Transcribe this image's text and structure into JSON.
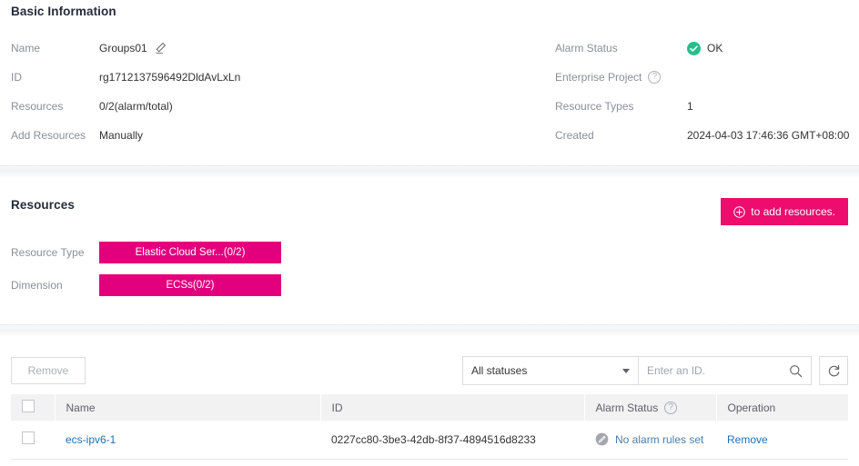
{
  "basic_information": {
    "title": "Basic Information",
    "left_rows": [
      {
        "label": "Name",
        "value": "Groups01",
        "icon": "pencil-icon"
      },
      {
        "label": "ID",
        "value": "rg1712137596492DldAvLxLn",
        "icon": ""
      },
      {
        "label": "Resources",
        "value": "0/2(alarm/total)",
        "icon": ""
      },
      {
        "label": "Add Resources",
        "value": "Manually",
        "icon": ""
      }
    ],
    "right_rows": [
      {
        "label": "Alarm Status",
        "value": "OK",
        "label_icon": "",
        "value_icon": "ok-check-icon"
      },
      {
        "label": "Enterprise Project",
        "value": "",
        "label_icon": "help-icon",
        "value_icon": ""
      },
      {
        "label": "Resource Types",
        "value": "1",
        "label_icon": "",
        "value_icon": ""
      },
      {
        "label": "Created",
        "value": "2024-04-03 17:46:36 GMT+08:00",
        "label_icon": "",
        "value_icon": ""
      }
    ]
  },
  "resources": {
    "title": "Resources",
    "add_button": {
      "label": "to add resources.",
      "icon": "plus-circle-icon"
    },
    "rows": [
      {
        "label": "Resource Type",
        "tag": "Elastic Cloud Ser...(0/2)"
      },
      {
        "label": "Dimension",
        "tag": "ECSs(0/2)"
      }
    ]
  },
  "list_area": {
    "remove_button": "Remove",
    "status_filter": {
      "selected": "All statuses"
    },
    "search": {
      "value": "",
      "placeholder": "Enter an ID."
    },
    "refresh_title": "Refresh",
    "table": {
      "columns": [
        "Name",
        "ID",
        "Alarm Status",
        "Operation"
      ],
      "alarm_status_help": "?",
      "rows": [
        {
          "name": "ecs-ipv6-1",
          "id": "0227cc80-3be3-42db-8f37-4894516d8233",
          "alarm_status": "No alarm rules set",
          "operation": "Remove"
        }
      ]
    }
  },
  "colors": {
    "brand_pink": "#e3007c",
    "button_pink": "#ec0d6e",
    "ok_green": "#25c08a",
    "link_blue": "#1d70b6",
    "label_grey": "#8a8e99"
  }
}
